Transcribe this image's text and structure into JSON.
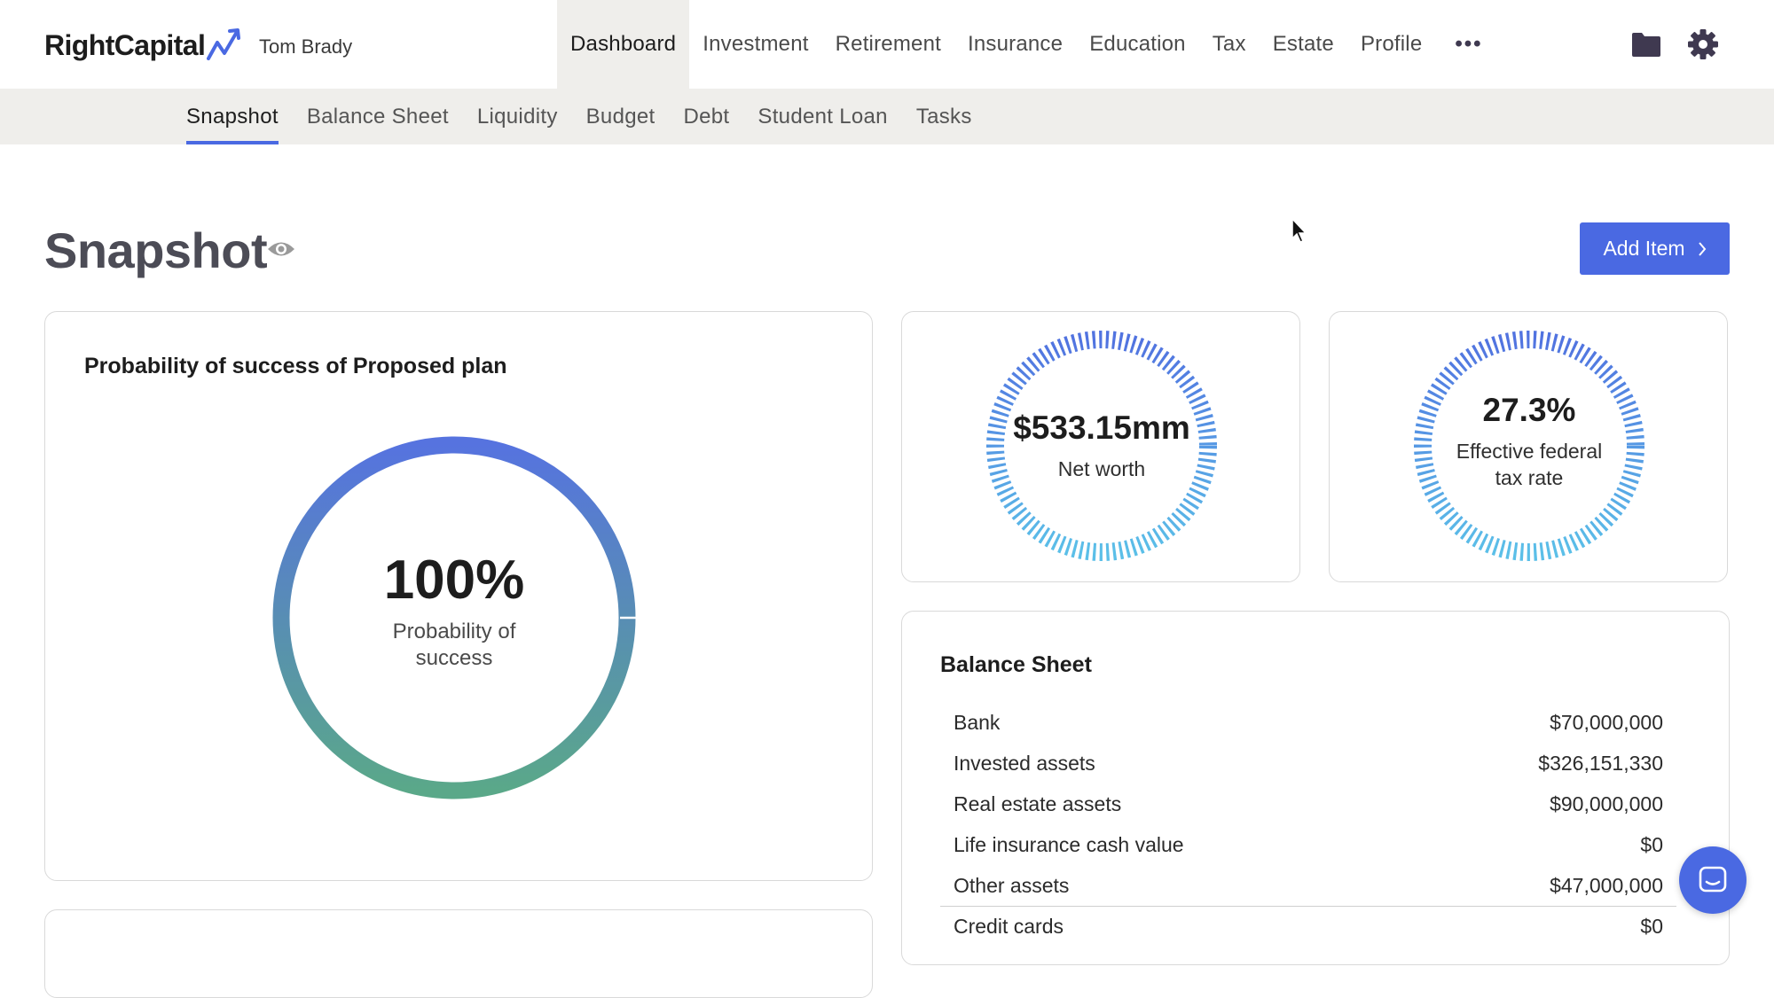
{
  "brand": {
    "logo_text": "RightCapital",
    "client_name": "Tom Brady"
  },
  "main_nav": [
    {
      "label": "Dashboard",
      "active": true
    },
    {
      "label": "Investment"
    },
    {
      "label": "Retirement"
    },
    {
      "label": "Insurance"
    },
    {
      "label": "Education"
    },
    {
      "label": "Tax"
    },
    {
      "label": "Estate"
    },
    {
      "label": "Profile"
    }
  ],
  "main_nav_more": "•••",
  "icons": {
    "folder": "folder-icon",
    "settings": "gear-icon",
    "visibility": "eye-icon",
    "chat": "chat-icon"
  },
  "sub_nav": [
    {
      "label": "Snapshot",
      "active": true
    },
    {
      "label": "Balance Sheet"
    },
    {
      "label": "Liquidity"
    },
    {
      "label": "Budget"
    },
    {
      "label": "Debt"
    },
    {
      "label": "Student Loan"
    },
    {
      "label": "Tasks"
    }
  ],
  "page": {
    "title": "Snapshot",
    "add_item_label": "Add Item"
  },
  "probability_card": {
    "title": "Probability of success of Proposed plan",
    "value": "100%",
    "label": "Probability of success",
    "fraction": 1.0
  },
  "net_worth_card": {
    "value": "$533.15mm",
    "label": "Net worth"
  },
  "tax_card": {
    "value": "27.3%",
    "label": "Effective federal tax rate"
  },
  "balance_sheet": {
    "title": "Balance Sheet",
    "rows": [
      {
        "label": "Bank",
        "value": "$70,000,000"
      },
      {
        "label": "Invested assets",
        "value": "$326,151,330"
      },
      {
        "label": "Real estate assets",
        "value": "$90,000,000"
      },
      {
        "label": "Life insurance cash value",
        "value": "$0"
      },
      {
        "label": "Other assets",
        "value": "$47,000,000"
      },
      {
        "label": "Credit cards",
        "value": "$0"
      }
    ]
  },
  "colors": {
    "accent": "#4a69e2",
    "donut_start": "#5673df",
    "donut_end": "#5aa889",
    "ring_start": "#5173e0",
    "ring_end": "#5bbfe8"
  }
}
